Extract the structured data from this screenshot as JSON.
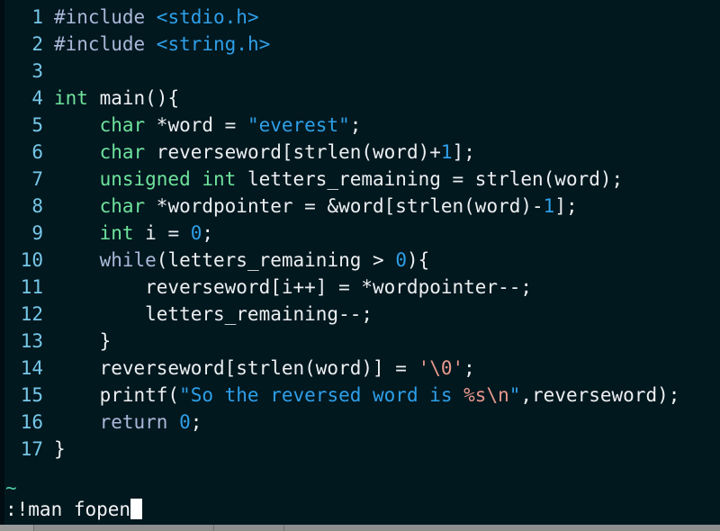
{
  "app": {
    "name": "vim",
    "background_color": "#02181f",
    "foreground_color": "#eceff1"
  },
  "colors": {
    "background": "#02181f",
    "line_number": "#76c7e8",
    "keyword_type": "#6fe39c",
    "keyword_control": "#a9b8d8",
    "string": "#2e9fe8",
    "number": "#2e9fe8",
    "char_literal": "#e8978c",
    "format_specifier": "#e8978c",
    "tilde": "#4ec9a0",
    "cursor": "#ffffff",
    "plain_text": "#eceff1"
  },
  "editor": {
    "language": "c",
    "lines": [
      {
        "number": "1",
        "tokens": [
          {
            "text": "#include ",
            "type": "pre"
          },
          {
            "text": "<stdio.h>",
            "type": "str"
          }
        ]
      },
      {
        "number": "2",
        "tokens": [
          {
            "text": "#include ",
            "type": "pre"
          },
          {
            "text": "<string.h>",
            "type": "str"
          }
        ]
      },
      {
        "number": "3",
        "tokens": []
      },
      {
        "number": "4",
        "tokens": [
          {
            "text": "int",
            "type": "kw"
          },
          {
            "text": " main(){",
            "type": "plain"
          }
        ]
      },
      {
        "number": "5",
        "tokens": [
          {
            "text": "    ",
            "type": "plain"
          },
          {
            "text": "char",
            "type": "kw"
          },
          {
            "text": " *word = ",
            "type": "plain"
          },
          {
            "text": "\"everest\"",
            "type": "str"
          },
          {
            "text": ";",
            "type": "plain"
          }
        ]
      },
      {
        "number": "6",
        "tokens": [
          {
            "text": "    ",
            "type": "plain"
          },
          {
            "text": "char",
            "type": "kw"
          },
          {
            "text": " reverseword[strlen(word)+",
            "type": "plain"
          },
          {
            "text": "1",
            "type": "num"
          },
          {
            "text": "];",
            "type": "plain"
          }
        ]
      },
      {
        "number": "7",
        "tokens": [
          {
            "text": "    ",
            "type": "plain"
          },
          {
            "text": "unsigned int",
            "type": "kw"
          },
          {
            "text": " letters_remaining = strlen(word);",
            "type": "plain"
          }
        ]
      },
      {
        "number": "8",
        "tokens": [
          {
            "text": "    ",
            "type": "plain"
          },
          {
            "text": "char",
            "type": "kw"
          },
          {
            "text": " *wordpointer = &word[strlen(word)-",
            "type": "plain"
          },
          {
            "text": "1",
            "type": "num"
          },
          {
            "text": "];",
            "type": "plain"
          }
        ]
      },
      {
        "number": "9",
        "tokens": [
          {
            "text": "    ",
            "type": "plain"
          },
          {
            "text": "int",
            "type": "kw"
          },
          {
            "text": " i = ",
            "type": "plain"
          },
          {
            "text": "0",
            "type": "num"
          },
          {
            "text": ";",
            "type": "plain"
          }
        ]
      },
      {
        "number": "10",
        "tokens": [
          {
            "text": "    ",
            "type": "plain"
          },
          {
            "text": "while",
            "type": "pre"
          },
          {
            "text": "(letters_remaining > ",
            "type": "plain"
          },
          {
            "text": "0",
            "type": "num"
          },
          {
            "text": "){",
            "type": "plain"
          }
        ]
      },
      {
        "number": "11",
        "tokens": [
          {
            "text": "        reverseword[i++] = *wordpointer--;",
            "type": "plain"
          }
        ]
      },
      {
        "number": "12",
        "tokens": [
          {
            "text": "        letters_remaining--;",
            "type": "plain"
          }
        ]
      },
      {
        "number": "13",
        "tokens": [
          {
            "text": "    }",
            "type": "plain"
          }
        ]
      },
      {
        "number": "14",
        "tokens": [
          {
            "text": "    reverseword[strlen(word)] = ",
            "type": "plain"
          },
          {
            "text": "'\\0'",
            "type": "char"
          },
          {
            "text": ";",
            "type": "plain"
          }
        ]
      },
      {
        "number": "15",
        "tokens": [
          {
            "text": "    printf(",
            "type": "plain"
          },
          {
            "text": "\"So the reversed word is ",
            "type": "str"
          },
          {
            "text": "%s\\n",
            "type": "spec"
          },
          {
            "text": "\"",
            "type": "str"
          },
          {
            "text": ",reverseword);",
            "type": "plain"
          }
        ]
      },
      {
        "number": "16",
        "tokens": [
          {
            "text": "    ",
            "type": "plain"
          },
          {
            "text": "return",
            "type": "pre"
          },
          {
            "text": " ",
            "type": "plain"
          },
          {
            "text": "0",
            "type": "num"
          },
          {
            "text": ";",
            "type": "plain"
          }
        ]
      },
      {
        "number": "17",
        "tokens": [
          {
            "text": "}",
            "type": "plain"
          }
        ]
      }
    ],
    "filler_lines": [
      "~"
    ]
  },
  "command_line": {
    "text": ":!man fopen",
    "cursor": "block",
    "cursor_visible": true
  },
  "bottom_strip": {
    "visible": true,
    "segments": [
      "",
      "",
      "",
      ""
    ]
  }
}
